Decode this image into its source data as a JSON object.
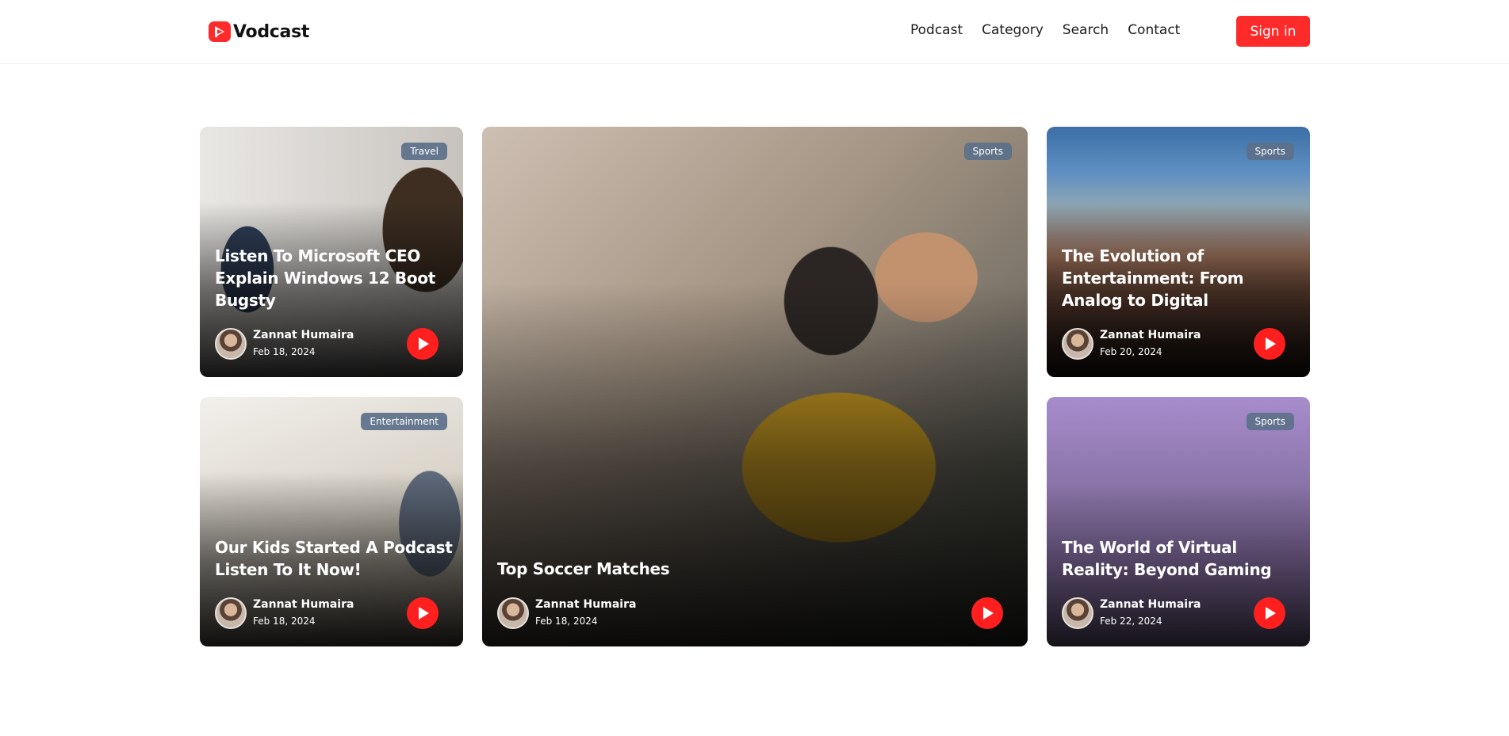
{
  "brand": {
    "name": "Vodcast",
    "accent": "#ff2a2a"
  },
  "nav": {
    "links": [
      "Podcast",
      "Category",
      "Search",
      "Contact"
    ],
    "sign_in": "Sign in"
  },
  "cards": [
    {
      "category": "Travel",
      "title": "Listen To Microsoft CEO Explain Windows 12 Boot Bugsty",
      "author": "Zannat Humaira",
      "date": "Feb 18, 2024"
    },
    {
      "category": "Entertainment",
      "title": "Our Kids Started A Podcast Listen To It Now!",
      "author": "Zannat Humaira",
      "date": "Feb 18, 2024"
    },
    {
      "category": "Sports",
      "title": "Top Soccer Matches",
      "author": "Zannat Humaira",
      "date": "Feb 18, 2024"
    },
    {
      "category": "Sports",
      "title": "The Evolution of Entertainment: From Analog to Digital",
      "author": "Zannat Humaira",
      "date": "Feb 20, 2024"
    },
    {
      "category": "Sports",
      "title": "The World of Virtual Reality: Beyond Gaming",
      "author": "Zannat Humaira",
      "date": "Feb 22, 2024"
    }
  ],
  "icons": {
    "logo": "play-logo-icon",
    "play": "play-icon"
  }
}
